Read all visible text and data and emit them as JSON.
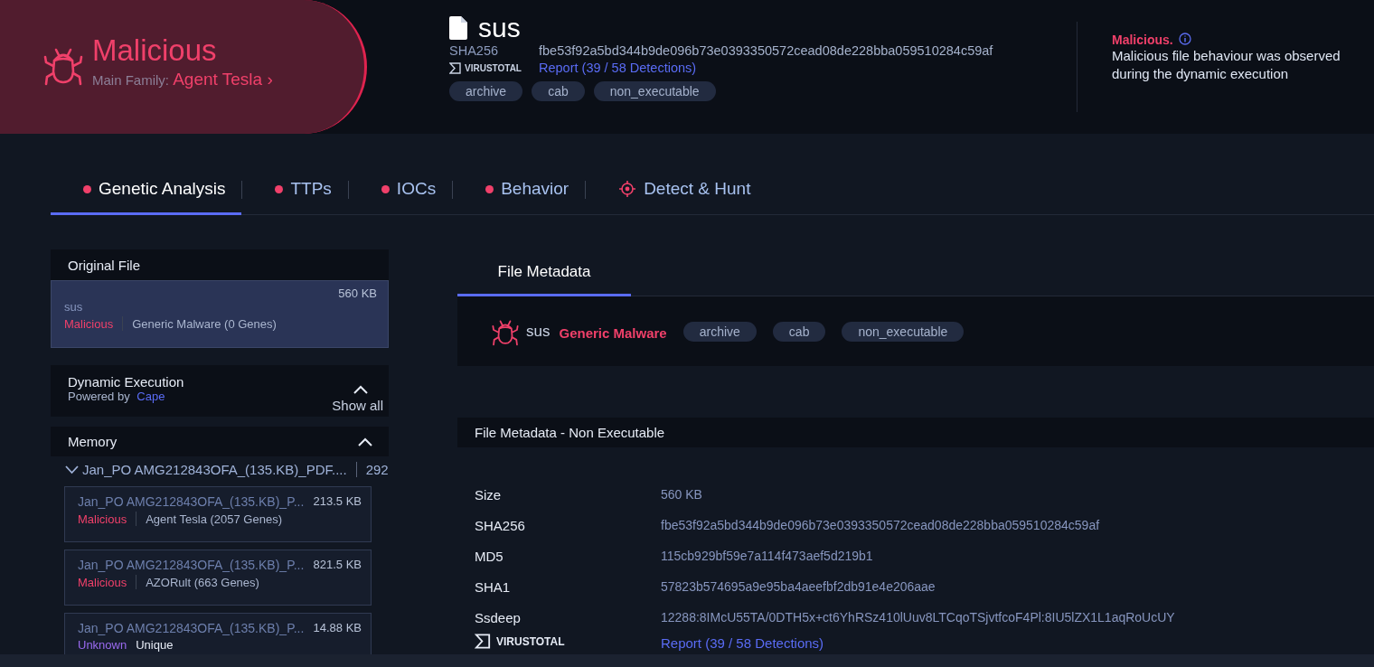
{
  "verdict": {
    "label": "Malicious",
    "family_label": "Main Family:",
    "family": "Agent Tesla",
    "chevron": "›"
  },
  "file": {
    "name": "sus",
    "hash_label": "SHA256",
    "hash": "fbe53f92a5bd344b9de096b73e0393350572cead08de228bba059510284c59af",
    "vt_logo": "VIRUSTOTAL",
    "vt_report": "Report (39 / 58 Detections)",
    "tags": [
      "archive",
      "cab",
      "non_executable"
    ]
  },
  "summary": {
    "verdict": "Malicious.",
    "text": "Malicious file behaviour was observed during the dynamic execution"
  },
  "tabs": [
    {
      "label": "Genetic Analysis",
      "kind": "dot",
      "selected": true
    },
    {
      "label": "TTPs",
      "kind": "dot",
      "selected": false
    },
    {
      "label": "IOCs",
      "kind": "dot",
      "selected": false
    },
    {
      "label": "Behavior",
      "kind": "dot",
      "selected": false
    },
    {
      "label": "Detect & Hunt",
      "kind": "target",
      "selected": false
    }
  ],
  "sidebar": {
    "original_file": {
      "title": "Original File",
      "item": {
        "name": "sus",
        "size": "560 KB",
        "verdict": "Malicious",
        "kind": "malicious",
        "family": "Generic Malware (0 Genes)",
        "selected": true
      }
    },
    "dynamic": {
      "title": "Dynamic Execution",
      "powered_by": "Powered by",
      "provider": "Cape",
      "show_all": "Show all",
      "expanded": true
    },
    "memory": {
      "title": "Memory",
      "expanded": true,
      "group": {
        "name": "Jan_PO AMG212843OFA_(135.KB)_PDF....",
        "count": "292",
        "expanded": true
      },
      "items": [
        {
          "name": "Jan_PO AMG212843OFA_(135.KB)_P...",
          "size": "213.5 KB",
          "verdict": "Malicious",
          "kind": "malicious",
          "family": "Agent Tesla (2057 Genes)"
        },
        {
          "name": "Jan_PO AMG212843OFA_(135.KB)_P...",
          "size": "821.5 KB",
          "verdict": "Malicious",
          "kind": "malicious",
          "family": "AZORult (663 Genes)"
        },
        {
          "name": "Jan_PO AMG212843OFA_(135.KB)_P...",
          "size": "14.88 KB",
          "verdict": "Unknown",
          "kind": "unknown",
          "family": "Unique"
        }
      ]
    }
  },
  "content": {
    "tab": {
      "label": "File Metadata",
      "selected": true
    },
    "file_card": {
      "name": "sus",
      "family": "Generic Malware",
      "tags": [
        "archive",
        "cab",
        "non_executable"
      ]
    },
    "section_title": "File Metadata - Non Executable",
    "rows": [
      {
        "label": "Size",
        "value": "560 KB"
      },
      {
        "label": "SHA256",
        "value": "fbe53f92a5bd344b9de096b73e0393350572cead08de228bba059510284c59af"
      },
      {
        "label": "MD5",
        "value": "115cb929bf59e7a114f473aef5d219b1"
      },
      {
        "label": "SHA1",
        "value": "57823b574695a9e95ba4aeefbf2db91e4e206aae"
      },
      {
        "label": "Ssdeep",
        "value": "12288:8IMcU55TA/0DTH5x+ct6YhRSz410lUuv8LTCqoTSjvtfcoF4Pl:8IU5lZX1L1aqRoUcUY"
      }
    ],
    "vt": {
      "logo": "VIRUSTOTAL",
      "report": "Report (39 / 58 Detections)"
    }
  }
}
